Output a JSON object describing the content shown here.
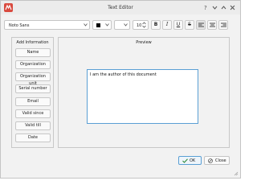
{
  "window": {
    "title": "Text Editor",
    "controls": [
      "help-icon",
      "chevron-down-icon",
      "chevron-up-icon",
      "close-icon"
    ]
  },
  "toolbar": {
    "font_family": "Noto Sans",
    "text_color": "#000000",
    "font_size": "10",
    "bold_glyph": "B",
    "italic_glyph": "I",
    "underline_glyph": "U",
    "strike_glyph": "S",
    "align_left_icon": "align-left-icon",
    "align_center_icon": "align-center-icon",
    "align_right_icon": "align-right-icon"
  },
  "left_panel": {
    "title": "Add Information",
    "buttons": [
      "Name",
      "Organization",
      "Organization unit",
      "Serial number",
      "Email",
      "Valid since",
      "Valid till",
      "Date"
    ]
  },
  "preview": {
    "title": "Preview",
    "text": "I am the author of this document"
  },
  "footer": {
    "ok_label": "OK",
    "cancel_label": "Close"
  },
  "colors": {
    "accent": "#5a9fd4",
    "app_icon": "#d94a3f",
    "ok_icon": "#2e8b3a"
  }
}
